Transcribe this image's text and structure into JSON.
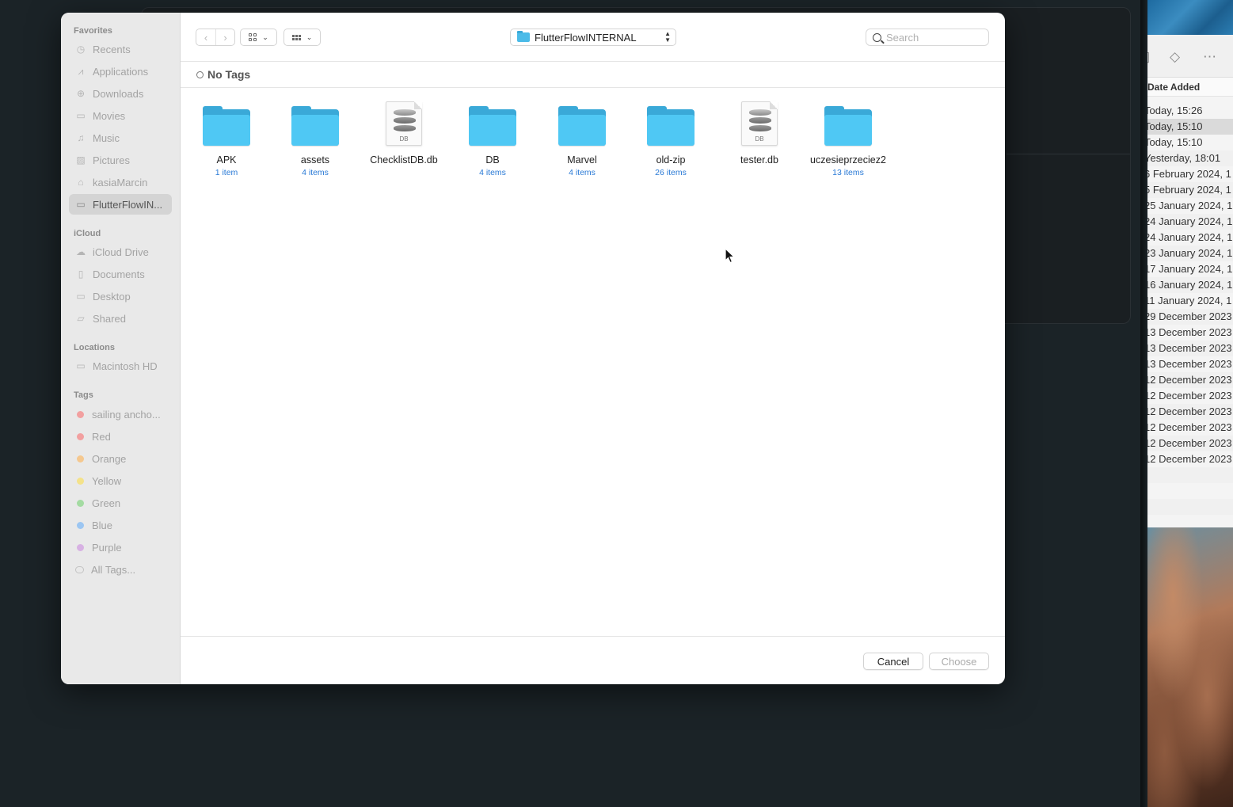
{
  "background_window": {
    "column_header": "Date Added",
    "dates": [
      "Today, 15:26",
      "Today, 15:10",
      "Today, 15:10",
      "Yesterday, 18:01",
      "6 February 2024, 1",
      "5 February 2024, 1",
      "25 January 2024, 1",
      "24 January 2024, 1",
      "24 January 2024, 1",
      "23 January 2024, 1",
      "17 January 2024, 1",
      "16 January 2024, 1",
      "11 January 2024, 1",
      "29 December 2023",
      "13 December 2023",
      "13 December 2023",
      "13 December 2023",
      "12 December 2023",
      "12 December 2023",
      "12 December 2023",
      "12 December 2023",
      "12 December 2023",
      "12 December 2023"
    ]
  },
  "sidebar": {
    "favorites_title": "Favorites",
    "favorites": [
      {
        "label": "Recents",
        "icon": "clock-icon"
      },
      {
        "label": "Applications",
        "icon": "applications-icon"
      },
      {
        "label": "Downloads",
        "icon": "download-icon"
      },
      {
        "label": "Movies",
        "icon": "film-icon"
      },
      {
        "label": "Music",
        "icon": "music-note-icon"
      },
      {
        "label": "Pictures",
        "icon": "photo-icon"
      },
      {
        "label": "kasiaMarcin",
        "icon": "home-icon"
      },
      {
        "label": "FlutterFlowIN...",
        "icon": "folder-icon",
        "active": true
      }
    ],
    "icloud_title": "iCloud",
    "icloud": [
      {
        "label": "iCloud Drive",
        "icon": "cloud-icon"
      },
      {
        "label": "Documents",
        "icon": "document-icon"
      },
      {
        "label": "Desktop",
        "icon": "desktop-icon"
      },
      {
        "label": "Shared",
        "icon": "shared-folder-icon"
      }
    ],
    "locations_title": "Locations",
    "locations": [
      {
        "label": "Macintosh HD",
        "icon": "drive-icon"
      }
    ],
    "tags_title": "Tags",
    "tags": [
      {
        "label": "sailing ancho...",
        "color": "#f2a0a0"
      },
      {
        "label": "Red",
        "color": "#f2a0a0"
      },
      {
        "label": "Orange",
        "color": "#f5c88f"
      },
      {
        "label": "Yellow",
        "color": "#f4e28a"
      },
      {
        "label": "Green",
        "color": "#a4dba2"
      },
      {
        "label": "Blue",
        "color": "#9cc6f2"
      },
      {
        "label": "Purple",
        "color": "#d7b1e3"
      },
      {
        "label": "All Tags...",
        "color": ""
      }
    ]
  },
  "toolbar": {
    "back": "‹",
    "forward": "›",
    "location": "FlutterFlowINTERNAL",
    "search_placeholder": "Search"
  },
  "tagbar": {
    "label": "No Tags"
  },
  "files": [
    {
      "name": "APK",
      "count": "1 item",
      "kind": "folder"
    },
    {
      "name": "assets",
      "count": "4 items",
      "kind": "folder"
    },
    {
      "name": "ChecklistDB.db",
      "count": "",
      "kind": "db"
    },
    {
      "name": "DB",
      "count": "4 items",
      "kind": "folder"
    },
    {
      "name": "Marvel",
      "count": "4 items",
      "kind": "folder"
    },
    {
      "name": "old-zip",
      "count": "26 items",
      "kind": "folder"
    },
    {
      "name": "tester.db",
      "count": "",
      "kind": "db"
    },
    {
      "name": "uczesieprzeciez2",
      "count": "13 items",
      "kind": "folder"
    }
  ],
  "db_badge": "DB",
  "footer": {
    "cancel": "Cancel",
    "choose": "Choose"
  },
  "colors": {
    "folder": "#4fc8f4",
    "item_count": "#2a7ad6"
  }
}
